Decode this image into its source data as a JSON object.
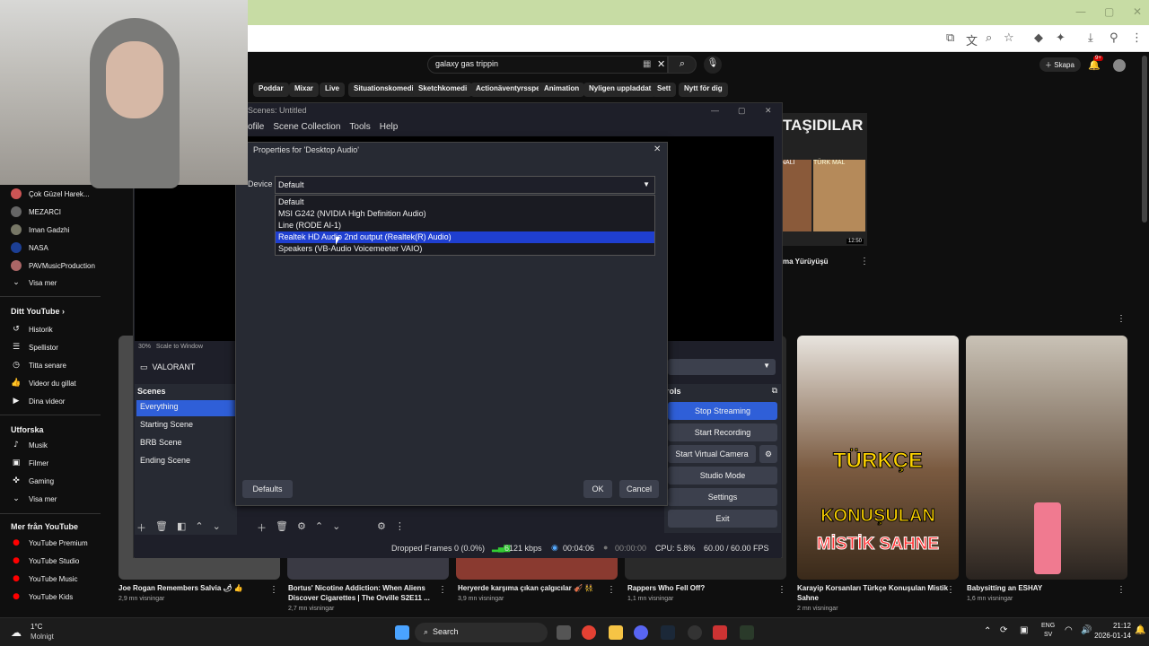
{
  "browser": {
    "search_query": "galaxy gas trippin",
    "create_label": "Skapa",
    "notif_count": "9+"
  },
  "chips": [
    "Poddar",
    "Mixar",
    "Live",
    "Situationskomedi",
    "Sketchkomedi",
    "Actionäventyrsspel",
    "Animation",
    "Nyligen uppladdat",
    "Sett",
    "Nytt för dig"
  ],
  "sidebar": {
    "subs": [
      "Çok Güzel Harek...",
      "MEZARCI",
      "Iman Gadzhi",
      "NASA",
      "PAVMusicProduction"
    ],
    "show_more": "Visa mer",
    "you_head": "Ditt YouTube",
    "you_items": [
      "Historik",
      "Spellistor",
      "Titta senare",
      "Videor du gillat",
      "Dina videor"
    ],
    "explore_head": "Utforska",
    "explore_items": [
      "Musik",
      "Filmer",
      "Gaming",
      "Visa mer"
    ],
    "more_head": "Mer från YouTube",
    "more_items": [
      "YouTube Premium",
      "YouTube Studio",
      "YouTube Music",
      "YouTube Kids"
    ]
  },
  "obs": {
    "title": "Scenes: Untitled",
    "menu": [
      "ofile",
      "Scene Collection",
      "Tools",
      "Help"
    ],
    "zoom": "30%",
    "scale_mode": "Scale to Window",
    "source": "VALORANT",
    "scenes_head": "Scenes",
    "scenes": [
      "Everything",
      "Starting Scene",
      "BRB Scene",
      "Ending Scene"
    ],
    "controls_head": "rols",
    "controls": [
      "Stop Streaming",
      "Start Recording",
      "Start Virtual Camera",
      "Studio Mode",
      "Settings",
      "Exit"
    ],
    "status": {
      "dropped": "Dropped Frames 0 (0.0%)",
      "kbps": "6121 kbps",
      "live_time": "00:04:06",
      "rec_time": "00:00:00",
      "cpu": "CPU: 5.8%",
      "fps": "60.00 / 60.00 FPS"
    }
  },
  "dialog": {
    "title": "Properties for 'Desktop Audio'",
    "device_label": "Device",
    "selected": "Default",
    "options": [
      "Default",
      "MSI G242 (NVIDIA High Definition Audio)",
      "Line (RODE AI-1)",
      "Realtek HD Audio 2nd output (Realtek(R) Audio)",
      "Speakers (VB-Audio Voicemeeter VAIO)"
    ],
    "highlighted_index": 3,
    "defaults_label": "Defaults",
    "ok_label": "OK",
    "cancel_label": "Cancel"
  },
  "featured": {
    "headline": "TAŞIDILAR",
    "tag1": "NALI",
    "tag2": "TÜRK MAL",
    "duration": "12:50",
    "caption": "ma Yürüyüşü"
  },
  "thumb_text": {
    "line1": "TÜRKÇE",
    "line2": "KONUŞULAN",
    "line3": "MİSTİK SAHNE"
  },
  "videos": [
    {
      "title": "Joe Rogan Remembers Salvia 🌶 👍",
      "views": "2,9 mn visningar"
    },
    {
      "title": "Bortus' Nicotine Addiction: When Aliens Discover Cigarettes | The Orville S2E11 ...",
      "views": "2,7 mn visningar"
    },
    {
      "title": "Heryerde karşıma çıkan çalgıcılar 🎻 👯",
      "views": "3,9 mn visningar"
    },
    {
      "title": "Rappers Who Fell Off?",
      "views": "1,1 mn visningar"
    },
    {
      "title": "Karayip Korsanları Türkçe Konuşulan Mistik Sahne",
      "views": "2 mn visningar"
    },
    {
      "title": "Babysitting an ESHAY",
      "views": "1,6 mn visningar"
    }
  ],
  "taskbar": {
    "temp": "1°C",
    "weather": "Molnigt",
    "search": "Search",
    "lang1": "ENG",
    "lang2": "SV",
    "time": "21:12",
    "date": "2026-01-14"
  }
}
